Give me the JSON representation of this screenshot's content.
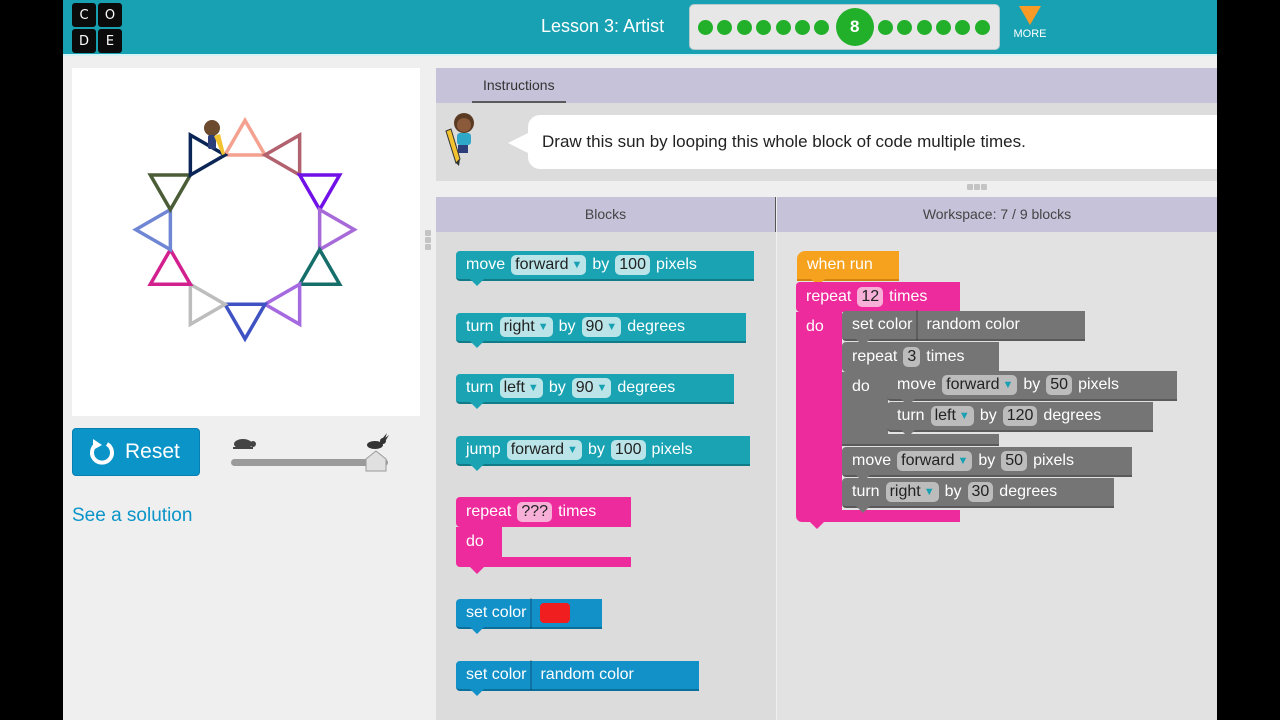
{
  "header": {
    "logo_letters": [
      "C",
      "O",
      "D",
      "E"
    ],
    "lesson_title": "Lesson 3: Artist",
    "progress": {
      "total_dots": 14,
      "current_level": "8",
      "before": 7,
      "after": 6
    },
    "more_label": "MORE",
    "colors": {
      "bar": "#17a1b2",
      "dot": "#22b02a",
      "more": "#f79b26"
    }
  },
  "left": {
    "reset_label": "Reset",
    "speed_slider": {
      "value_fraction": 1.0
    },
    "see_solution": "See a solution",
    "drawing": {
      "triangle_colors": [
        "#f4a190",
        "#b2616e",
        "#7111e8",
        "#a66ad9",
        "#166e6a",
        "#a66ae0",
        "#3f52c4",
        "#bdbdbd",
        "#d2208f",
        "#6f86d4",
        "#4b5d36",
        "#0a2556"
      ]
    }
  },
  "instructions": {
    "tab_label": "Instructions",
    "text": "Draw this sun by looping this whole block of code multiple times."
  },
  "toolbox": {
    "header": "Blocks",
    "blocks": [
      {
        "words": [
          "move",
          "forward",
          "by",
          "100",
          "pixels"
        ]
      },
      {
        "words": [
          "turn",
          "right",
          "by",
          "90",
          "degrees"
        ]
      },
      {
        "words": [
          "turn",
          "left",
          "by",
          "90",
          "degrees"
        ]
      },
      {
        "words": [
          "jump",
          "forward",
          "by",
          "100",
          "pixels"
        ]
      },
      {
        "repeat": "repeat",
        "count": "???",
        "times": "times",
        "do": "do"
      },
      {
        "set_color": "set color",
        "color": "#f01e1e"
      },
      {
        "set_color": "set color",
        "value": "random color"
      }
    ]
  },
  "workspace": {
    "header": "Workspace: 7 / 9 blocks",
    "when_run": "when run",
    "outer_repeat": {
      "label": "repeat",
      "count": "12",
      "times": "times",
      "do": "do"
    },
    "set_color": {
      "label": "set color",
      "value": "random color"
    },
    "inner_repeat": {
      "label": "repeat",
      "count": "3",
      "times": "times",
      "do": "do"
    },
    "inner_move": {
      "verb": "move",
      "dir": "forward",
      "by": "by",
      "amount": "50",
      "unit": "pixels"
    },
    "inner_turn": {
      "verb": "turn",
      "dir": "left",
      "by": "by",
      "amount": "120",
      "unit": "degrees"
    },
    "outer_move": {
      "verb": "move",
      "dir": "forward",
      "by": "by",
      "amount": "50",
      "unit": "pixels"
    },
    "outer_turn": {
      "verb": "turn",
      "dir": "right",
      "by": "by",
      "amount": "30",
      "unit": "degrees"
    }
  }
}
